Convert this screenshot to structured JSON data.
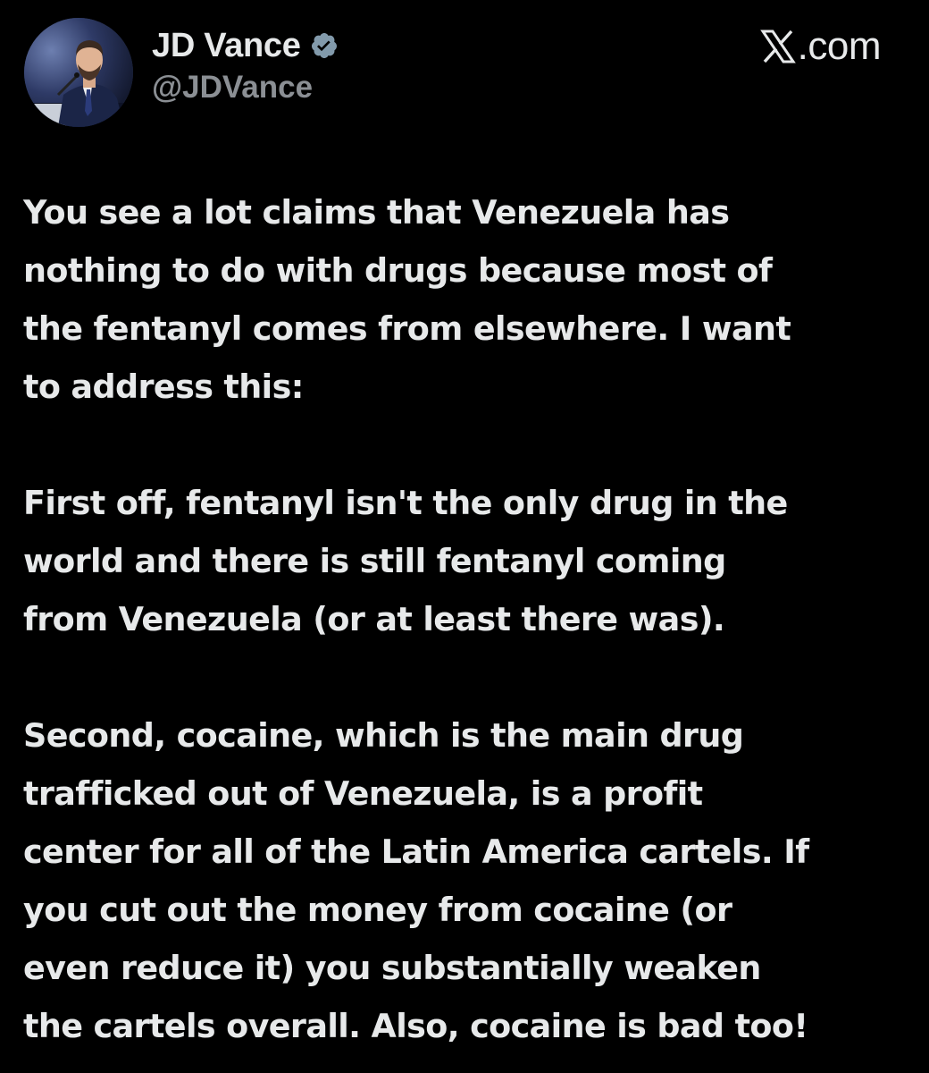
{
  "author": {
    "display_name": "JD Vance",
    "handle": "@JDVance",
    "verified": true,
    "avatar_icon": "profile-photo-speaker-at-podium"
  },
  "brand": {
    "logo_icon": "x-logo-icon",
    "text": ".com"
  },
  "tweet": {
    "paragraphs": [
      "You see a lot claims that Venezuela has\nnothing to do with drugs because most of\nthe fentanyl comes from elsewhere. I want\nto address this:",
      "First off, fentanyl isn't the only drug in the\nworld and there is still fentanyl coming\nfrom Venezuela (or at least there was).",
      "Second, cocaine, which is the main drug\ntrafficked out of Venezuela, is a profit\ncenter for all of the Latin America cartels. If\nyou cut out the money from cocaine (or\neven reduce it) you substantially weaken\nthe cartels overall. Also, cocaine is bad too!"
    ]
  },
  "colors": {
    "background": "#000000",
    "text": "#e7e9ea",
    "secondary_text": "#8b8f94",
    "verified_badge": "#829aab"
  }
}
